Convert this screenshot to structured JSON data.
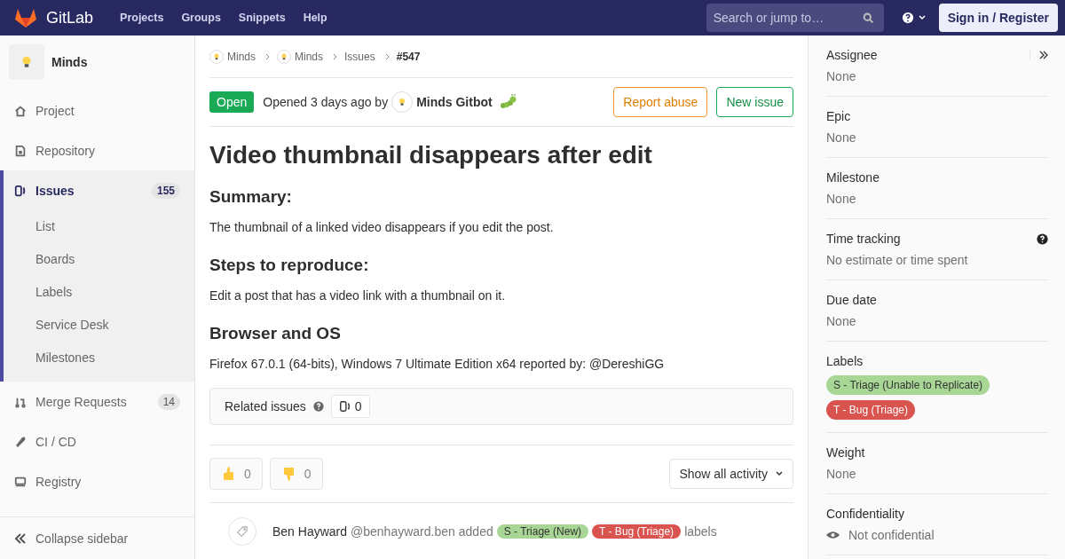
{
  "navbar": {
    "brand": "GitLab",
    "links": [
      "Projects",
      "Groups",
      "Snippets",
      "Help"
    ],
    "search": {
      "placeholder": "Search or jump to…"
    },
    "signin": "Sign in / Register"
  },
  "sidebar": {
    "project": "Minds",
    "items": [
      {
        "label": "Project",
        "selected": false
      },
      {
        "label": "Repository",
        "selected": false
      },
      {
        "label": "Issues",
        "count": "155",
        "selected": true,
        "children": [
          {
            "label": "List"
          },
          {
            "label": "Boards"
          },
          {
            "label": "Labels"
          },
          {
            "label": "Service Desk"
          },
          {
            "label": "Milestones"
          }
        ]
      },
      {
        "label": "Merge Requests",
        "count": "14",
        "selected": false
      },
      {
        "label": "CI / CD",
        "selected": false
      },
      {
        "label": "Registry",
        "selected": false
      }
    ],
    "collapse": "Collapse sidebar"
  },
  "breadcrumbs": [
    {
      "label": "Minds",
      "avatar": true
    },
    {
      "label": "Minds",
      "avatar": true
    },
    {
      "label": "Issues",
      "avatar": false
    },
    {
      "label": "#547",
      "avatar": false
    }
  ],
  "issue": {
    "status": "Open",
    "opened": "Opened 3 days ago by",
    "author": "Minds Gitbot",
    "actions": [
      "Report abuse",
      "New issue"
    ],
    "title": "Video thumbnail disappears after edit",
    "body": [
      {
        "kind": "heading",
        "text": "Summary:"
      },
      {
        "kind": "paragraph",
        "text": "The thumbnail of a linked video disappears if you edit the post."
      },
      {
        "kind": "heading",
        "text": "Steps to reproduce:"
      },
      {
        "kind": "paragraph",
        "text": "Edit a post that has a video link with a thumbnail on it."
      },
      {
        "kind": "heading",
        "text": "Browser and OS"
      },
      {
        "kind": "paragraph",
        "text": "Firefox 67.0.1 (64-bits), Windows 7 Ultimate Edition x64 reported by: @DereshiGG"
      }
    ],
    "related": {
      "label": "Related issues",
      "count": "0"
    },
    "reactions": [
      {
        "kind": "up",
        "count": "0"
      },
      {
        "kind": "down",
        "count": "0"
      }
    ],
    "activity_filter": "Show all activity",
    "note": {
      "name": "Ben Hayward",
      "handle": "@benhayward.ben",
      "verb": "added",
      "labels": [
        {
          "text": "S - Triage (New)",
          "color": "#a8d695"
        },
        {
          "text": "T - Bug (Triage)",
          "color": "#d9534f"
        }
      ],
      "suffix": "labels"
    }
  },
  "right_sidebar": [
    {
      "kind": "plain",
      "title": "Assignee",
      "value": "None",
      "collapse": true
    },
    {
      "kind": "plain",
      "title": "Epic",
      "value": "None"
    },
    {
      "kind": "plain",
      "title": "Milestone",
      "value": "None"
    },
    {
      "kind": "plain",
      "title": "Time tracking",
      "value": "No estimate or time spent",
      "help": true
    },
    {
      "kind": "plain",
      "title": "Due date",
      "value": "None"
    },
    {
      "kind": "labels",
      "title": "Labels",
      "labels": [
        {
          "text": "S - Triage (Unable to Replicate)",
          "color": "#a8d695"
        },
        {
          "text": "T - Bug (Triage)",
          "color": "#d9534f"
        }
      ]
    },
    {
      "kind": "plain",
      "title": "Weight",
      "value": "None"
    },
    {
      "kind": "eye",
      "title": "Confidentiality",
      "value": "Not confidential"
    }
  ]
}
